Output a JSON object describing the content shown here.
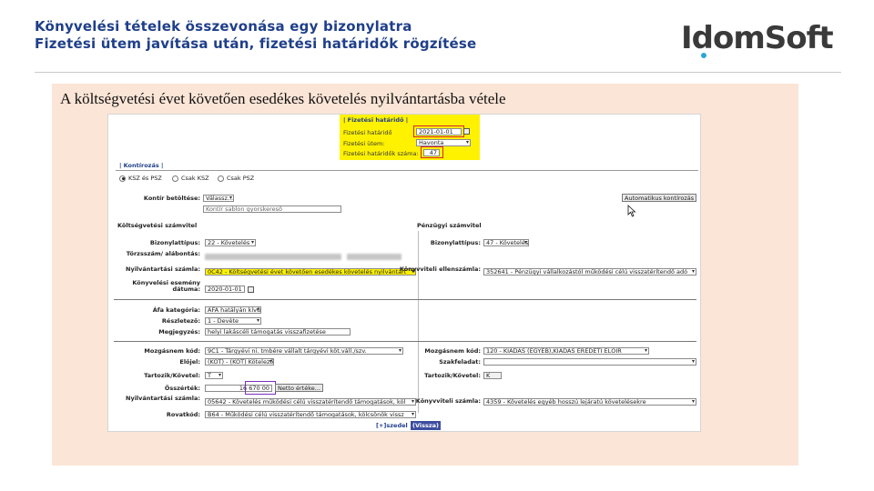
{
  "slide": {
    "title_line1": "Könyvelési tételek összevonása egy bizonylatra",
    "title_line2": "Fizetési ütem javítása után, fizetési határidők rögzítése",
    "logo": "IdomSoft",
    "caption": "A költségvetési évet követően esedékes követelés nyilvántartásba vétele"
  },
  "payment_due": {
    "section_title": "| Fizetési határidő |",
    "due_date_label": "Fizetési határidő",
    "due_date_value": "2021-01-01",
    "schedule_label": "Fizetési ütem:",
    "schedule_value": "Havonta",
    "count_label": "Fizetési határidők száma:",
    "count_value": "47"
  },
  "accounting": {
    "tab_label": "| Kontírozás |",
    "radio_options": [
      "KSZ és PSZ",
      "Csak KSZ",
      "Csak PSZ"
    ],
    "load_label": "Kontír betöltése:",
    "load_placeholder": "Válassz...",
    "template_input": "Kontír sablon gyorskereső",
    "auto_button": "Automatikus kontírozás",
    "budget_section": "Költségvetési számvitel",
    "financial_section": "Pénzügyi számvitel",
    "voucher_type_label": "Bizonylattípus:",
    "voucher_type_value": "22 - Követelés",
    "voucher_type_value_fin": "47 - Követelés pé...",
    "partner_label": "Törzsszám/ alábontás:",
    "registry_label": "Nyilvántartási számla:",
    "registry_value": "0C42 - Költségvetési évet követően esedékes követelés nyilvántart",
    "booking_date_label": "Könyvelési esemény dátuma:",
    "booking_date_value": "2020-01-01",
    "counter_account_label": "Könyvviteli ellenszámla:",
    "counter_account_value": "352641 - Pénzügyi vállalkozástól működési célú visszatérítendő adó",
    "vat_label": "Áfa kategória:",
    "vat_value": "ÁFA hatályán kívüli",
    "part_label": "Részletező:",
    "part_value": "1 - Devète",
    "note_label": "Megjegyzés:",
    "note_value": "helyi lakáscéli támogatás visszafizetése",
    "movement_label": "Mozgásnem kód:",
    "movement_value": "9C1 - Tárgyévi ni. tmbére vállalt tárgyévi köt.váll./szv.",
    "movement_value_fin": "120 - KIADÁS (EGYEB),KIADÁS EREDETI ELŐIR",
    "sign_label": "Előjel:",
    "sign_value": "(KÖT) - (KÖT) Kötelező",
    "branch_label": "Szakfeladat:",
    "debit_label": "Tartozik/Követel:",
    "debit_value": "T",
    "debit_value_fin": "K",
    "amount_label": "Összérték:",
    "amount_value": "16 670 00",
    "other_value_button": "Netto értéke...",
    "registry2_label": "Nyilvántartási számla:",
    "registry2_value": "05642 - Követelés működési célú visszatérítendő támogatások, köl",
    "book_account_label": "Könyvviteli számla:",
    "book_account_value": "4359 - Követelés egyéb hosszú lejáratú követelésekre",
    "item_label": "Rovatkód:",
    "item_value": "B64 - Működési célú visszatérítendő támogatások, kölcsönök vissz",
    "add_link": "[+]szedel",
    "back_button": "(Vissza)"
  }
}
